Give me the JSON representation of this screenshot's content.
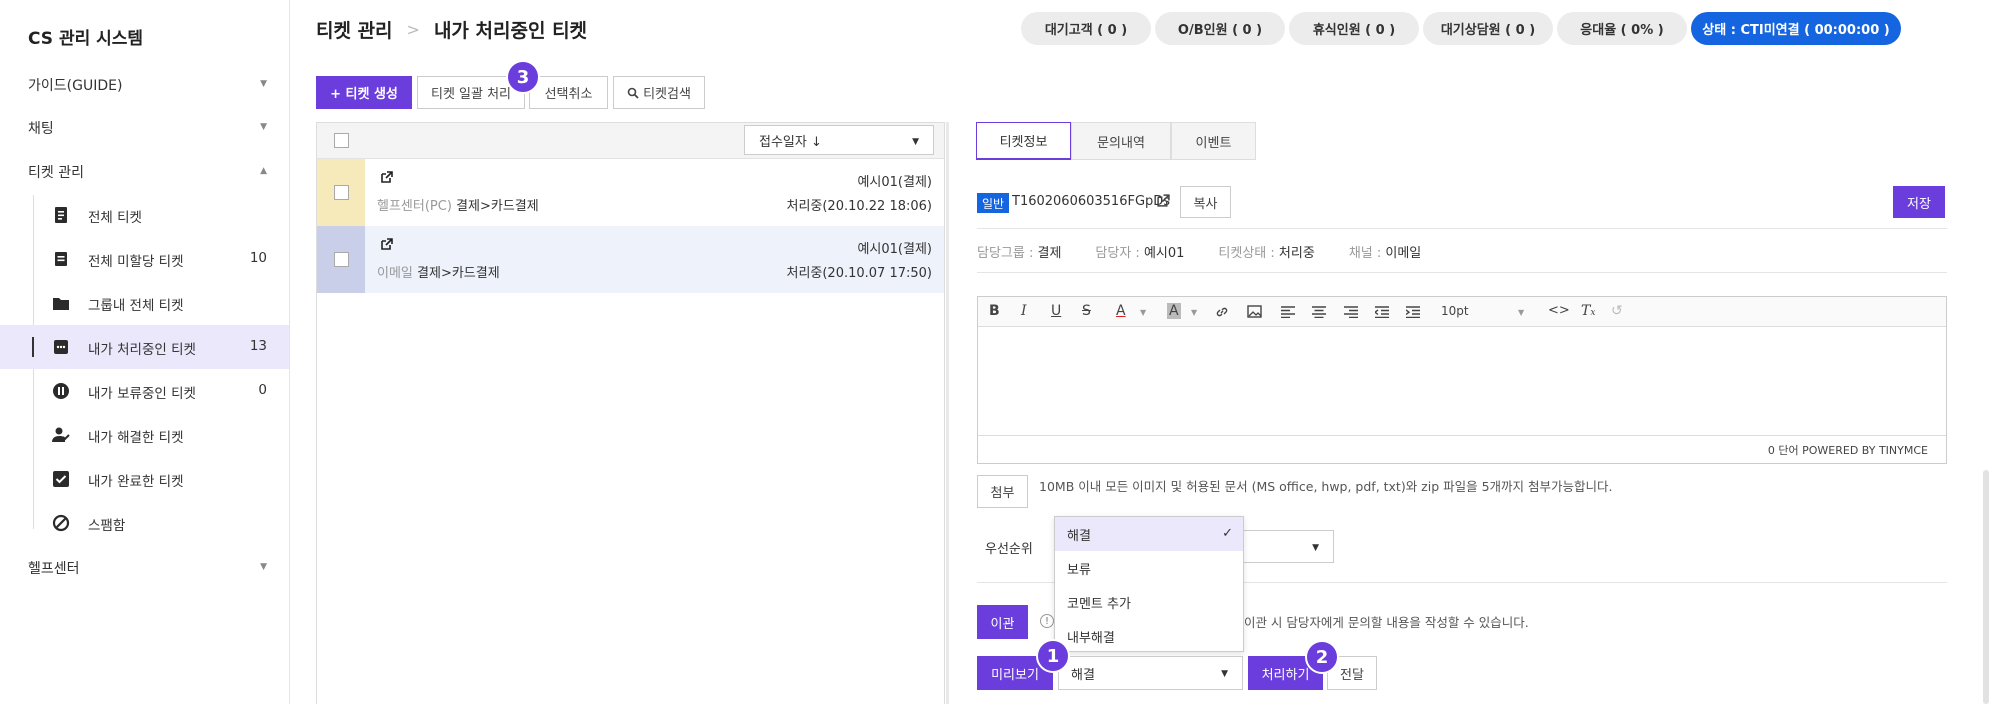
{
  "sidebar": {
    "title": "CS 관리 시스템",
    "menus": [
      {
        "label": "가이드(GUIDE)",
        "chevron": "▼"
      },
      {
        "label": "채팅",
        "chevron": "▼"
      },
      {
        "label": "티켓 관리",
        "chevron": "▲"
      },
      {
        "label": "헬프센터",
        "chevron": "▼"
      }
    ],
    "ticket_items": [
      {
        "label": "전체 티켓",
        "count": "",
        "icon": "document-icon"
      },
      {
        "label": "전체 미할당 티켓",
        "count": "10",
        "icon": "note-icon"
      },
      {
        "label": "그룹내 전체 티켓",
        "count": "",
        "icon": "folder-icon"
      },
      {
        "label": "내가 처리중인 티켓",
        "count": "13",
        "icon": "chat-dots-icon"
      },
      {
        "label": "내가 보류중인 티켓",
        "count": "0",
        "icon": "pause-icon"
      },
      {
        "label": "내가 해결한 티켓",
        "count": "",
        "icon": "user-check-icon"
      },
      {
        "label": "내가 완료한 티켓",
        "count": "",
        "icon": "checkbox-icon"
      },
      {
        "label": "스팸함",
        "count": "",
        "icon": "ban-icon"
      }
    ]
  },
  "header": {
    "breadcrumb": [
      "티켓 관리",
      "내가 처리중인 티켓"
    ],
    "separator": ">",
    "status_pills": [
      "대기고객 ( 0 )",
      "O/B인원 ( 0 )",
      "휴식인원 ( 0 )",
      "대기상담원 ( 0 )",
      "응대율 ( 0% )"
    ],
    "cti_status": "상태 : CTI미연결 ( 00:00:00 )"
  },
  "toolbar": {
    "create": "+ 티켓 생성",
    "bulk": "티켓 일괄 처리",
    "deselect": "선택취소",
    "search": "티켓검색"
  },
  "badges": [
    "1",
    "2",
    "3"
  ],
  "list": {
    "sort_label": "접수일자 ↓",
    "rows": [
      {
        "channel": "헬프센터(PC)",
        "category": "결제>카드결제",
        "owner": "예시01(결제)",
        "status_time": "처리중(20.10.22 18:06)",
        "stripe": "#f7eaba",
        "bg": "#ffffff"
      },
      {
        "channel": "이메일",
        "category": "결제>카드결제",
        "owner": "예시01(결제)",
        "status_time": "처리중(20.10.07 17:50)",
        "stripe": "#c9cfe8",
        "bg": "#eef2fb"
      }
    ]
  },
  "detail": {
    "tabs": [
      "티켓정보",
      "문의내역",
      "이벤트"
    ],
    "type_tag": "일반",
    "ticket_id": "T1602060603516FGpDs",
    "copy_label": "복사",
    "save_label": "저장",
    "meta": [
      {
        "key": "담당그룹 : ",
        "value": "결제"
      },
      {
        "key": "담당자 : ",
        "value": "예시01"
      },
      {
        "key": "티켓상태 : ",
        "value": "처리중"
      },
      {
        "key": "채널 : ",
        "value": "이메일"
      }
    ],
    "editor": {
      "font_size": "10pt",
      "footer": "0 단어 POWERED BY TINYMCE"
    },
    "attach_label": "첨부",
    "attach_hint": "10MB 이내 모든 이미지 및 허용된 문서 (MS office, hwp, pdf, txt)와 zip 파일을 5개까지 첨부가능합니다.",
    "priority_label": "우선순위",
    "transfer_label": "이관",
    "transfer_hint": "니다. 이관 시 담당자에게 문의할 내용을 작성할 수 있습니다.",
    "dropdown_options": [
      "해결",
      "보류",
      "코멘트 추가",
      "내부해결"
    ],
    "preview_label": "미리보기",
    "action_value": "해결",
    "process_label": "처리하기",
    "forward_label": "전달"
  },
  "colors": {
    "accent": "#6a3ddc",
    "status": "#1565e0"
  }
}
